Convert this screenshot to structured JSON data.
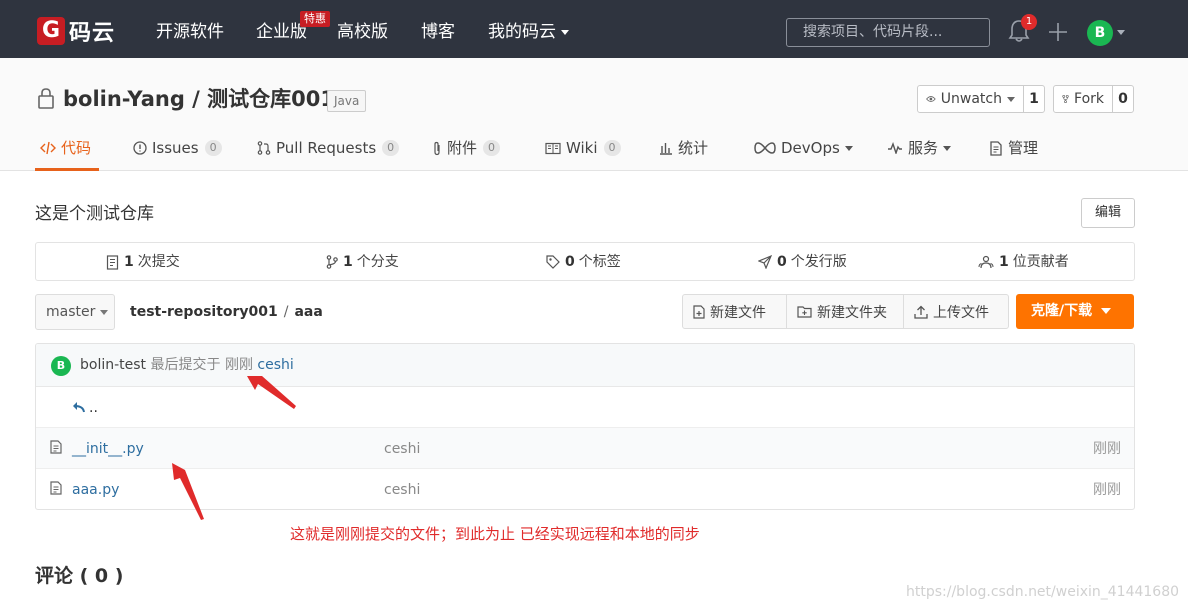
{
  "header": {
    "logo_letter": "G",
    "logo_text": "码云",
    "nav": [
      "开源软件",
      "企业版",
      "高校版",
      "博客",
      "我的码云"
    ],
    "enterprise_badge": "特惠",
    "search_placeholder": "搜索项目、代码片段...",
    "notification_count": "1",
    "avatar_letter": "B"
  },
  "repo": {
    "title": "bolin-Yang / 测试仓库001",
    "language": "Java",
    "watch_label": "Unwatch",
    "watch_count": "1",
    "fork_label": "Fork",
    "fork_count": "0"
  },
  "tabs": [
    {
      "label": "代码"
    },
    {
      "label": "Issues",
      "count": "0"
    },
    {
      "label": "Pull Requests",
      "count": "0"
    },
    {
      "label": "附件",
      "count": "0"
    },
    {
      "label": "Wiki",
      "count": "0"
    },
    {
      "label": "统计"
    },
    {
      "label": "DevOps"
    },
    {
      "label": "服务"
    },
    {
      "label": "管理"
    }
  ],
  "description": "这是个测试仓库",
  "edit_label": "编辑",
  "stats": [
    {
      "num": "1",
      "label": "次提交"
    },
    {
      "num": "1",
      "label": "个分支"
    },
    {
      "num": "0",
      "label": "个标签"
    },
    {
      "num": "0",
      "label": "个发行版"
    },
    {
      "num": "1",
      "label": "位贡献者"
    }
  ],
  "branch": "master",
  "path": {
    "root": "test-repository001",
    "sep": "/",
    "dir": "aaa"
  },
  "file_actions": [
    "新建文件",
    "新建文件夹",
    "上传文件"
  ],
  "clone_label": "克隆/下载",
  "last_commit": {
    "avatar_letter": "B",
    "user": "bolin-test",
    "prefix": "最后提交于",
    "time": "刚刚",
    "message": "ceshi"
  },
  "parent_dir": "..",
  "files": [
    {
      "name": "__init__.py",
      "message": "ceshi",
      "time": "刚刚"
    },
    {
      "name": "aaa.py",
      "message": "ceshi",
      "time": "刚刚"
    }
  ],
  "annotation": "这就是刚刚提交的文件；到此为止  已经实现远程和本地的同步",
  "comments_title": "评论 ( 0 )",
  "watermark": "https://blog.csdn.net/weixin_41441680",
  "colors": {
    "accent": "#fe7300",
    "header_bg": "#2f343f",
    "link": "#2e6ea0",
    "annotation": "#e02b2b"
  }
}
